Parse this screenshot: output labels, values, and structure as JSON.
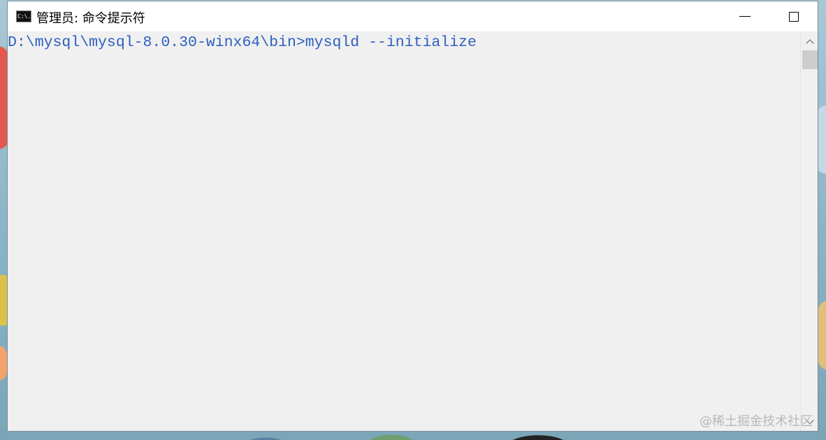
{
  "window": {
    "title": "管理员: 命令提示符",
    "icon_text": "C:\\."
  },
  "caption_buttons": {
    "minimize": "minimize-icon",
    "maximize": "maximize-icon",
    "close": "close-icon"
  },
  "console": {
    "line1": "D:\\mysql\\mysql-8.0.30-winx64\\bin>mysqld --initialize",
    "text_color": "#2d5fc0",
    "background": "#f0f0f0"
  },
  "watermark": "@稀土掘金技术社区"
}
